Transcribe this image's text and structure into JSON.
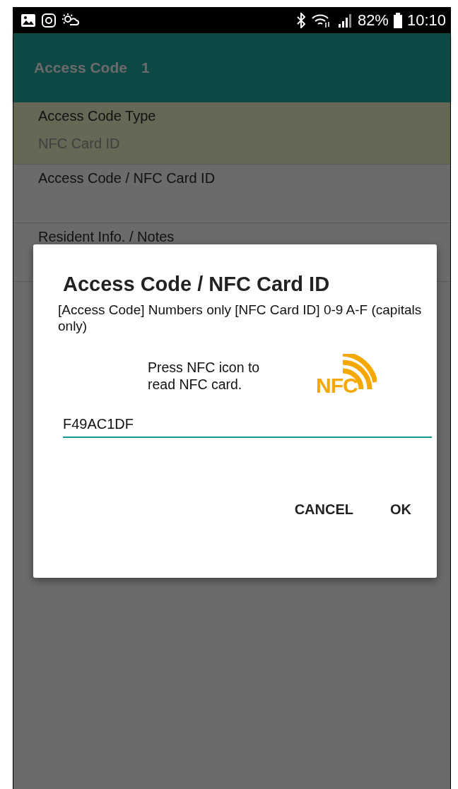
{
  "status_bar": {
    "battery": "82%",
    "time": "10:10"
  },
  "toolbar": {
    "title": "Access Code",
    "number": "1"
  },
  "fields": [
    {
      "label": "Access Code Type",
      "value": "NFC Card ID",
      "selected": true
    },
    {
      "label": "Access Code / NFC Card ID",
      "selected": false
    },
    {
      "label": "Resident Info. / Notes",
      "selected": false
    }
  ],
  "dialog": {
    "title": "Access Code / NFC Card ID",
    "message": "[Access Code] Numbers only [NFC Card ID] 0-9 A-F (capitals only)",
    "hint": "Press NFC icon to read NFC card.",
    "nfc_label": "NFC",
    "input": {
      "value": "F49AC1DF"
    },
    "buttons": [
      "CANCEL",
      "OK"
    ]
  }
}
